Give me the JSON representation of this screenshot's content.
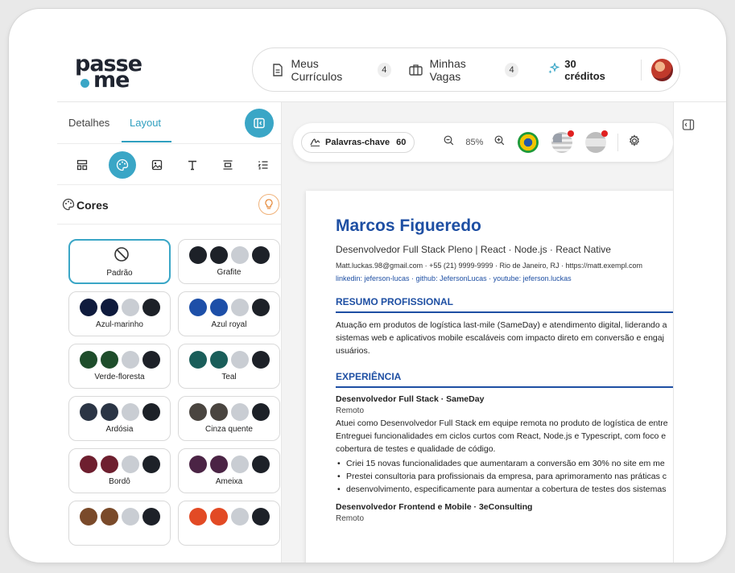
{
  "brand": {
    "line1": "passe",
    "line2": "me",
    "dot_color": "#3aa6c6"
  },
  "nav": {
    "curriculos": {
      "label": "Meus Currículos",
      "count": "4"
    },
    "vagas": {
      "label": "Minhas Vagas",
      "count": "4"
    },
    "credits": "30 créditos"
  },
  "tabs": {
    "details": "Detalhes",
    "layout": "Layout"
  },
  "cores": {
    "title": "Cores"
  },
  "palettes": [
    {
      "label": "Padrão",
      "colors": []
    },
    {
      "label": "Grafite",
      "colors": [
        "#1d2128",
        "#1d2128",
        "#c9cdd3",
        "#1d2128"
      ]
    },
    {
      "label": "Azul-marinho",
      "colors": [
        "#0f1b3d",
        "#0f1b3d",
        "#c9cdd3",
        "#1d2128"
      ]
    },
    {
      "label": "Azul royal",
      "colors": [
        "#1d4fa8",
        "#1d4fa8",
        "#c9cdd3",
        "#1d2128"
      ]
    },
    {
      "label": "Verde-floresta",
      "colors": [
        "#1e4d2b",
        "#1e4d2b",
        "#c9cdd3",
        "#1d2128"
      ]
    },
    {
      "label": "Teal",
      "colors": [
        "#1a5e5a",
        "#1a5e5a",
        "#c9cdd3",
        "#1d2128"
      ]
    },
    {
      "label": "Ardósia",
      "colors": [
        "#2b3545",
        "#2b3545",
        "#c9cdd3",
        "#1d2128"
      ]
    },
    {
      "label": "Cinza quente",
      "colors": [
        "#4a4540",
        "#4a4540",
        "#c9cdd3",
        "#1d2128"
      ]
    },
    {
      "label": "Bordô",
      "colors": [
        "#6e1f2f",
        "#6e1f2f",
        "#c9cdd3",
        "#1d2128"
      ]
    },
    {
      "label": "Ameixa",
      "colors": [
        "#4b2445",
        "#4b2445",
        "#c9cdd3",
        "#1d2128"
      ]
    },
    {
      "label": "",
      "colors": [
        "#7a4a2a",
        "#7a4a2a",
        "#c9cdd3",
        "#1d2128"
      ]
    },
    {
      "label": "",
      "colors": [
        "#e24a25",
        "#e24a25",
        "#c9cdd3",
        "#1d2128"
      ]
    }
  ],
  "toolbar": {
    "keywords_label": "Palavras-chave",
    "keywords_count": "60",
    "zoom": "85%"
  },
  "cv": {
    "name": "Marcos Figueredo",
    "role": "Desenvolvedor Full Stack Pleno | React · Node.js · React Native",
    "contact": "Matt.luckas.98@gmail.com · +55 (21) 9999-9999 · Rio de Janeiro, RJ · https://matt.exempl.com",
    "links": "linkedin: jeferson-lucas · github: JefersonLucas · youtube: jeferson.luckas",
    "summary_title": "RESUMO PROFISSIONAL",
    "summary_lines": [
      "Atuação em produtos de logística last-mile (SameDay) e atendimento digital, liderando a",
      "sistemas web e aplicativos mobile escaláveis com impacto direto em conversão e engaj",
      "usuários."
    ],
    "experience_title": "EXPERIÊNCIA",
    "job1": {
      "title": "Desenvolvedor Full Stack · SameDay",
      "location": "Remoto",
      "lines": [
        "Atuei como Desenvolvedor Full Stack em equipe remota no produto de logística de entre",
        "Entreguei funcionalidades em ciclos curtos com React, Node.js e Typescript, com foco e",
        "cobertura de testes e qualidade de código."
      ],
      "bullets": [
        "Criei 15 novas funcionalidades que aumentaram a conversão em 30% no site em me",
        "Prestei consultoria para profissionais da empresa, para aprimoramento nas práticas c",
        "desenvolvimento, especificamente para aumentar a cobertura de testes dos sistemas"
      ]
    },
    "job2": {
      "title": "Desenvolvedor Frontend e Mobile · 3eConsulting",
      "location": "Remoto"
    }
  },
  "accent_color": "#3aa6c6",
  "cv_color": "#1e4fa3"
}
